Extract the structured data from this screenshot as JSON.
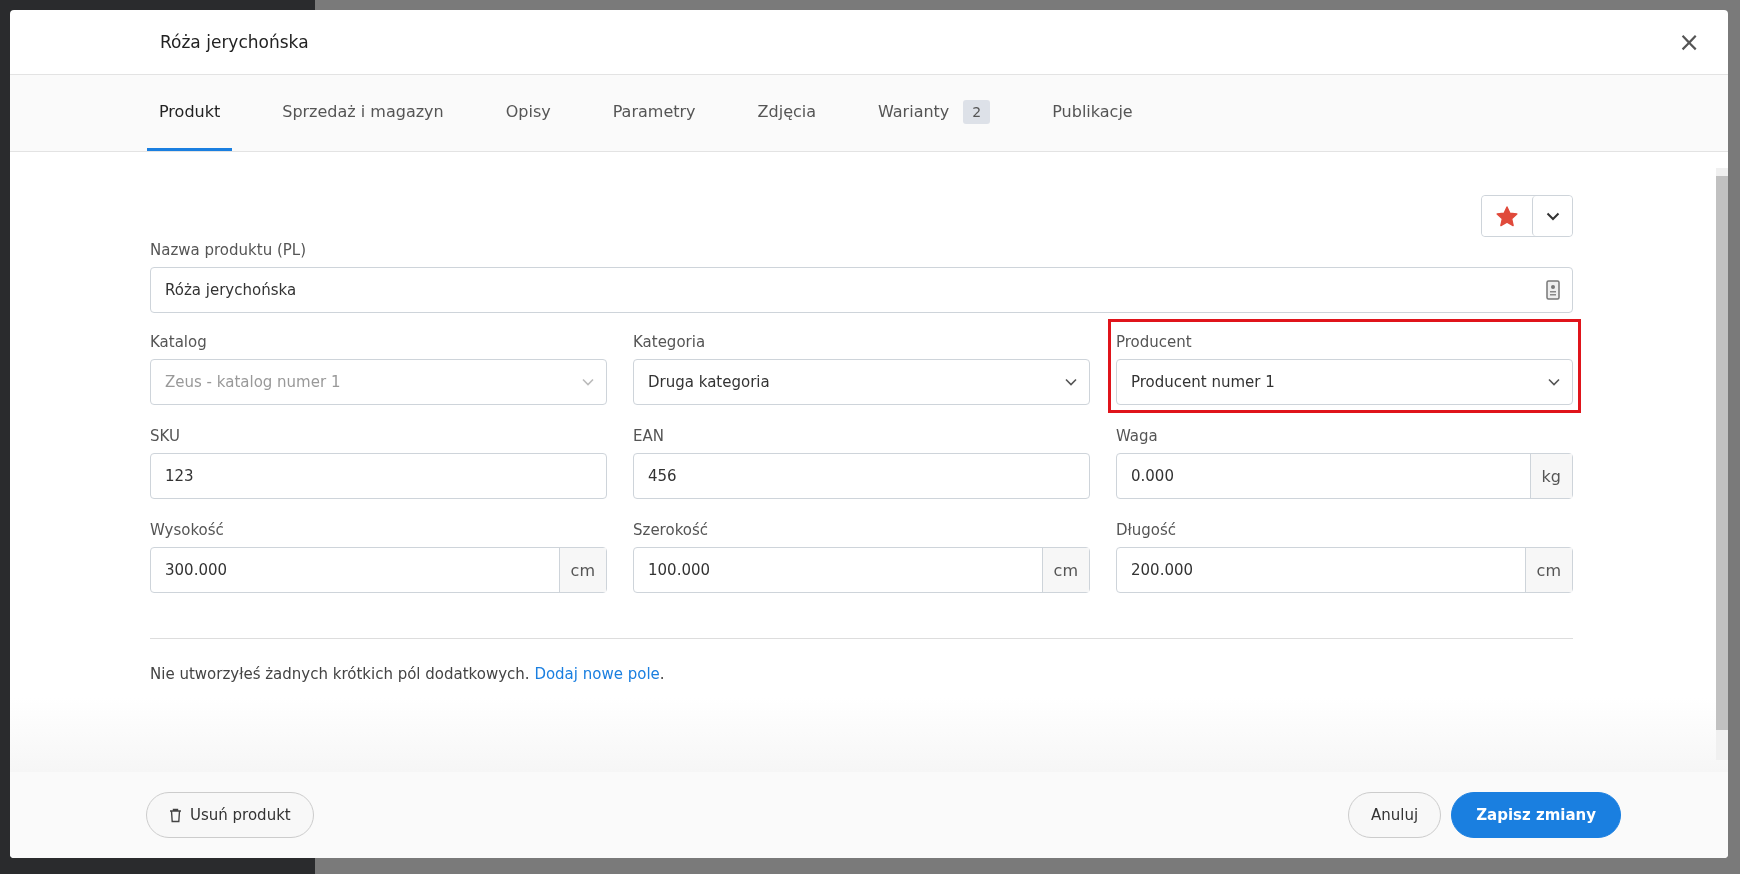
{
  "dialog": {
    "title": "Róża jerychońska",
    "close": "×"
  },
  "tabs": [
    {
      "label": "Produkt",
      "selected": true
    },
    {
      "label": "Sprzedaż i magazyn",
      "selected": false
    },
    {
      "label": "Opisy",
      "selected": false
    },
    {
      "label": "Parametry",
      "selected": false
    },
    {
      "label": "Zdjęcia",
      "selected": false
    },
    {
      "label": "Warianty",
      "selected": false,
      "badge": "2"
    },
    {
      "label": "Publikacje",
      "selected": false
    }
  ],
  "favorite": {
    "starred": true
  },
  "name_field": {
    "label": "Nazwa produktu (PL)",
    "value": "Róża jerychońska"
  },
  "fields": [
    {
      "label": "Katalog",
      "value": "Zeus - katalog numer 1",
      "kind": "select",
      "disabled": true,
      "highlighted": false
    },
    {
      "label": "Kategoria",
      "value": "Druga kategoria",
      "kind": "select",
      "disabled": false,
      "highlighted": false
    },
    {
      "label": "Producent",
      "value": "Producent numer 1",
      "kind": "select",
      "disabled": false,
      "highlighted": true
    },
    {
      "label": "SKU",
      "value": "123",
      "kind": "input",
      "disabled": false,
      "highlighted": false
    },
    {
      "label": "EAN",
      "value": "456",
      "kind": "input",
      "disabled": false,
      "highlighted": false
    },
    {
      "label": "Waga",
      "value": "0.000",
      "kind": "input",
      "unit": "kg",
      "disabled": false,
      "highlighted": false
    },
    {
      "label": "Wysokość",
      "value": "300.000",
      "kind": "input",
      "unit": "cm",
      "disabled": false,
      "highlighted": false
    },
    {
      "label": "Szerokość",
      "value": "100.000",
      "kind": "input",
      "unit": "cm",
      "disabled": false,
      "highlighted": false
    },
    {
      "label": "Długość",
      "value": "200.000",
      "kind": "input",
      "unit": "cm",
      "disabled": false,
      "highlighted": false
    }
  ],
  "note": {
    "text": "Nie utworzyłeś żadnych krótkich pól dodatkowych.",
    "link": "Dodaj nowe pole",
    "end": "."
  },
  "footer": {
    "delete": "Usuń produkt",
    "cancel": "Anuluj",
    "save": "Zapisz zmiany"
  }
}
